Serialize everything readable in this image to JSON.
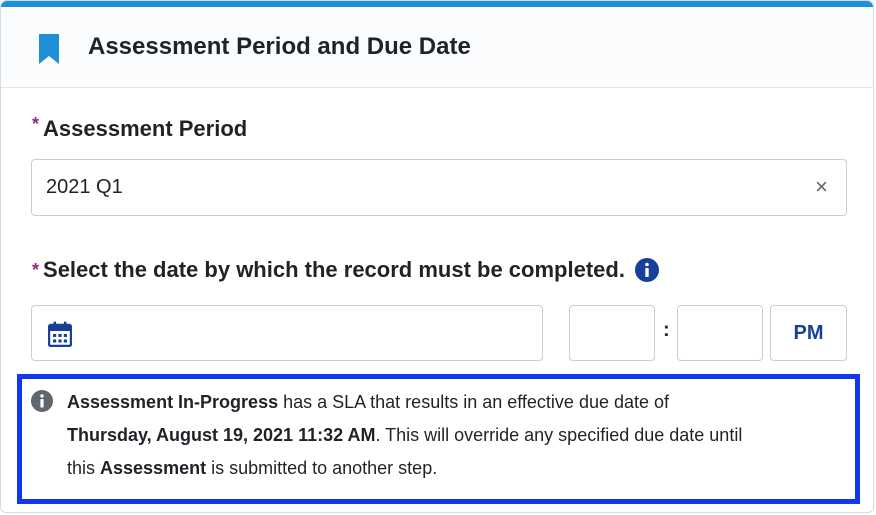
{
  "header": {
    "title": "Assessment Period and Due Date",
    "icon": "bookmark-icon",
    "accent_color": "#1f8fd6"
  },
  "assessment_period": {
    "required_marker": "*",
    "label": "Assessment Period",
    "value": "2021 Q1",
    "clear_icon": "×"
  },
  "due_date": {
    "required_marker": "*",
    "label": "Select the date by which the record must be completed.",
    "info_icon": "info-icon",
    "date_value": "",
    "hour_value": "",
    "time_separator": ":",
    "minute_value": "",
    "ampm": "PM"
  },
  "notice": {
    "border_color": "#1238ef",
    "part1_bold": "Assessment In-Progress",
    "part2": " has a SLA that results in an effective due date of",
    "part3_bold": "Thursday, August 19, 2021 11:32 AM",
    "part4": ". This will override any specified due date until this ",
    "part5_bold": "Assessment",
    "part6": " is submitted to another step."
  }
}
